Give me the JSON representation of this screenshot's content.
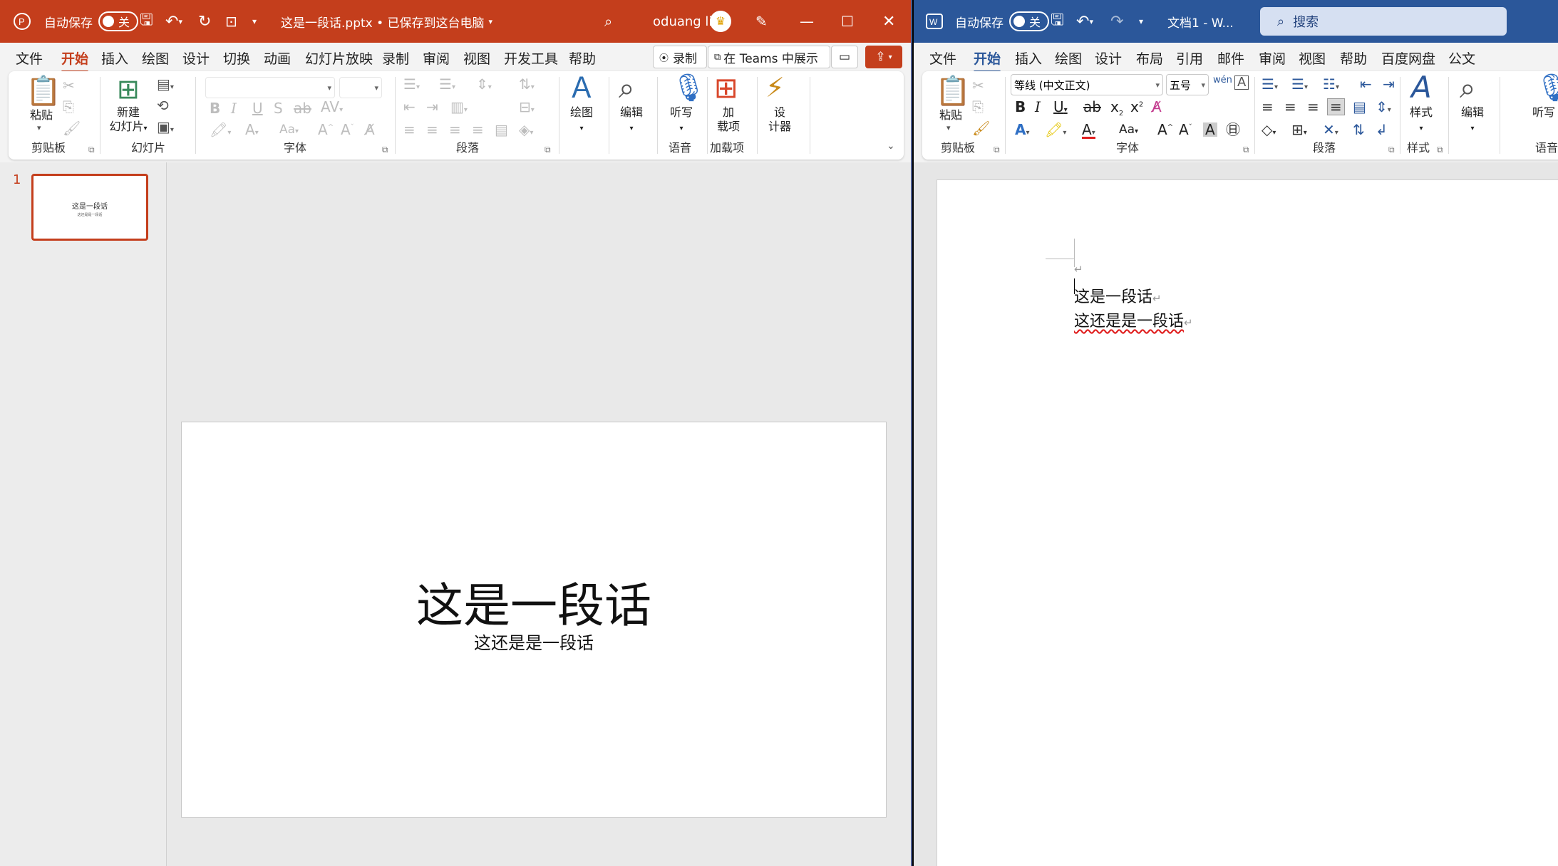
{
  "ppt": {
    "title": {
      "autosave": "自动保存",
      "toggle": "关",
      "filename": "这是一段话.pptx • 已保存到这台电脑",
      "user": "oduang li"
    },
    "tabs": [
      "文件",
      "开始",
      "插入",
      "绘图",
      "设计",
      "切换",
      "动画",
      "幻灯片放映",
      "录制",
      "审阅",
      "视图",
      "开发工具",
      "帮助"
    ],
    "actions": {
      "record": "录制",
      "teams": "在 Teams 中展示"
    },
    "ribbon": {
      "paste": "粘贴",
      "new_slide_1": "新建",
      "new_slide_2": "幻灯片",
      "draw": "绘图",
      "edit": "编辑",
      "dictate": "听写",
      "addin_1": "加",
      "addin_2": "载项",
      "designer_1": "设",
      "designer_2": "计器",
      "groups": {
        "clipboard": "剪贴板",
        "slides": "幻灯片",
        "font": "字体",
        "paragraph": "段落",
        "voice": "语音",
        "addins": "加载项"
      }
    },
    "thumb": {
      "number": "1",
      "title": "这是一段话",
      "subtitle": "这还是是一段话"
    },
    "slide": {
      "title": "这是一段话",
      "subtitle": "这还是是一段话"
    }
  },
  "word": {
    "title": {
      "autosave": "自动保存",
      "toggle": "关",
      "filename": "文档1 - W...",
      "search": "搜索"
    },
    "tabs": [
      "文件",
      "开始",
      "插入",
      "绘图",
      "设计",
      "布局",
      "引用",
      "邮件",
      "审阅",
      "视图",
      "帮助",
      "百度网盘",
      "公文"
    ],
    "ribbon": {
      "paste": "粘贴",
      "font_name": "等线 (中文正文)",
      "font_size": "五号",
      "styles": "样式",
      "edit": "编辑",
      "dictate": "听写",
      "groups": {
        "clipboard": "剪贴板",
        "font": "字体",
        "paragraph": "段落",
        "styles": "样式",
        "voice": "语音"
      }
    },
    "doc": {
      "line1": "这是一段话",
      "line2": "这还是是一段话",
      "mark": "↵"
    }
  }
}
